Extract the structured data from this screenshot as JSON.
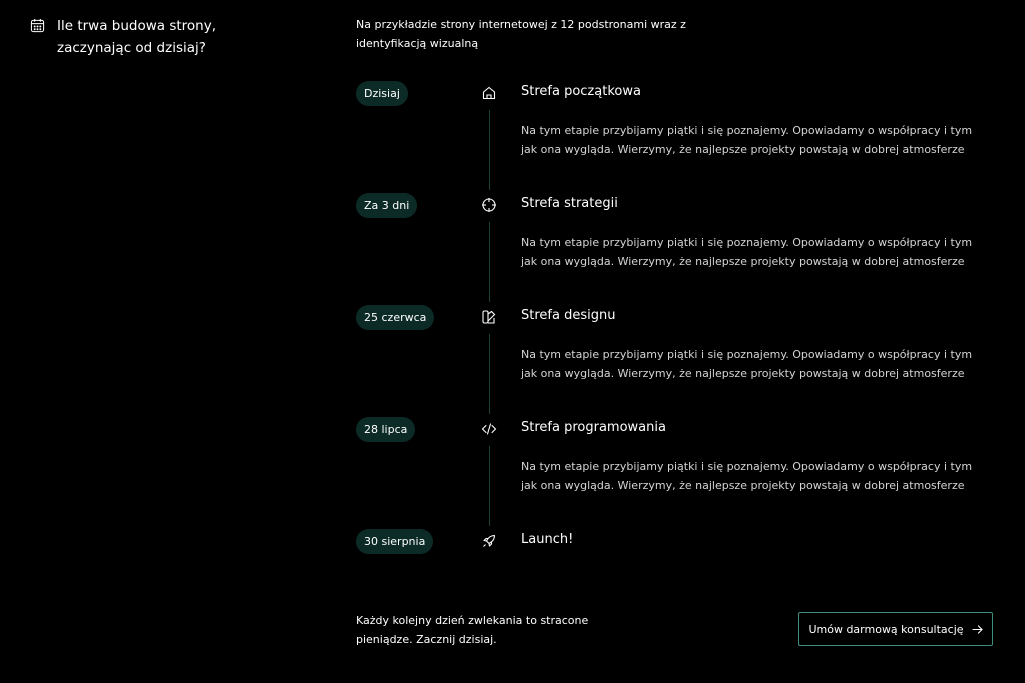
{
  "header": {
    "title": "Ile trwa budowa strony, zaczynając od dzisiaj?",
    "icon": "calendar-icon"
  },
  "intro": "Na przykładzie strony internetowej z 12 podstronami wraz z identyfikacją wizualną",
  "stages": [
    {
      "date": "Dzisiaj",
      "title": "Strefa początkowa",
      "icon": "home-icon",
      "description": "Na tym etapie przybijamy piątki i się poznajemy. Opowiadamy o współpracy i tym jak ona wygląda. Wierzymy, że najlepsze projekty powstają w dobrej atmosferze"
    },
    {
      "date": "Za 3 dni",
      "title": "Strefa strategii",
      "icon": "crosshair-icon",
      "description": "Na tym etapie przybijamy piątki i się poznajemy. Opowiadamy o współpracy i tym jak ona wygląda. Wierzymy, że najlepsze projekty powstają w dobrej atmosferze"
    },
    {
      "date": "25 czerwca",
      "title": "Strefa designu",
      "icon": "design-icon",
      "description": "Na tym etapie przybijamy piątki i się poznajemy. Opowiadamy o współpracy i tym jak ona wygląda. Wierzymy, że najlepsze projekty powstają w dobrej atmosferze"
    },
    {
      "date": "28 lipca",
      "title": "Strefa programowania",
      "icon": "code-icon",
      "description": "Na tym etapie przybijamy piątki i się poznajemy. Opowiadamy o współpracy i tym jak ona wygląda. Wierzymy, że najlepsze projekty powstają w dobrej atmosferze"
    },
    {
      "date": "30 sierpnia",
      "title": "Launch!",
      "icon": "rocket-icon"
    }
  ],
  "footer": {
    "text": "Każdy kolejny dzień zwlekania to stracone pieniądze. Zacznij dzisiaj.",
    "cta_label": "Umów darmową konsultację",
    "cta_icon": "arrow-right-icon"
  },
  "colors": {
    "background": "#000000",
    "pill": "#0c2b27",
    "accent_border": "#3f8f80",
    "timeline_line": "#1d3f3a"
  }
}
